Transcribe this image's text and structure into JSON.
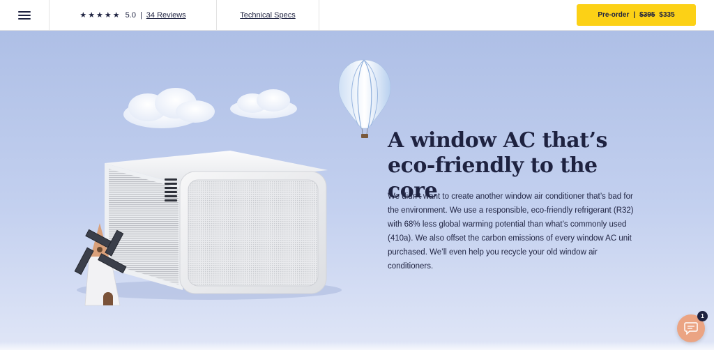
{
  "nav": {
    "rating_stars": "★★★★★",
    "rating_value": "5.0",
    "rating_separator": "|",
    "reviews_label": "34 Reviews",
    "specs_label": "Technical Specs",
    "preorder": {
      "label": "Pre-order",
      "separator": "|",
      "old_price": "$395",
      "new_price": "$335"
    }
  },
  "hero": {
    "headline": "A window AC that’s eco-friendly to the core",
    "body": "We didn’t want to create another window air conditioner that’s bad for the environment. We use a responsible, eco-friendly refrigerant (R32) with 68% less global warming potential than what’s commonly used (410a). We also offset the carbon emissions of every window AC unit purchased. We’ll even help you recycle your old window air conditioners.",
    "background": "#aebfe6"
  },
  "chat": {
    "icon": "chat-bubble-icon",
    "badge_count": "1",
    "color": "#eba483"
  },
  "colors": {
    "accent": "#fcd116",
    "text": "#1e2240"
  }
}
